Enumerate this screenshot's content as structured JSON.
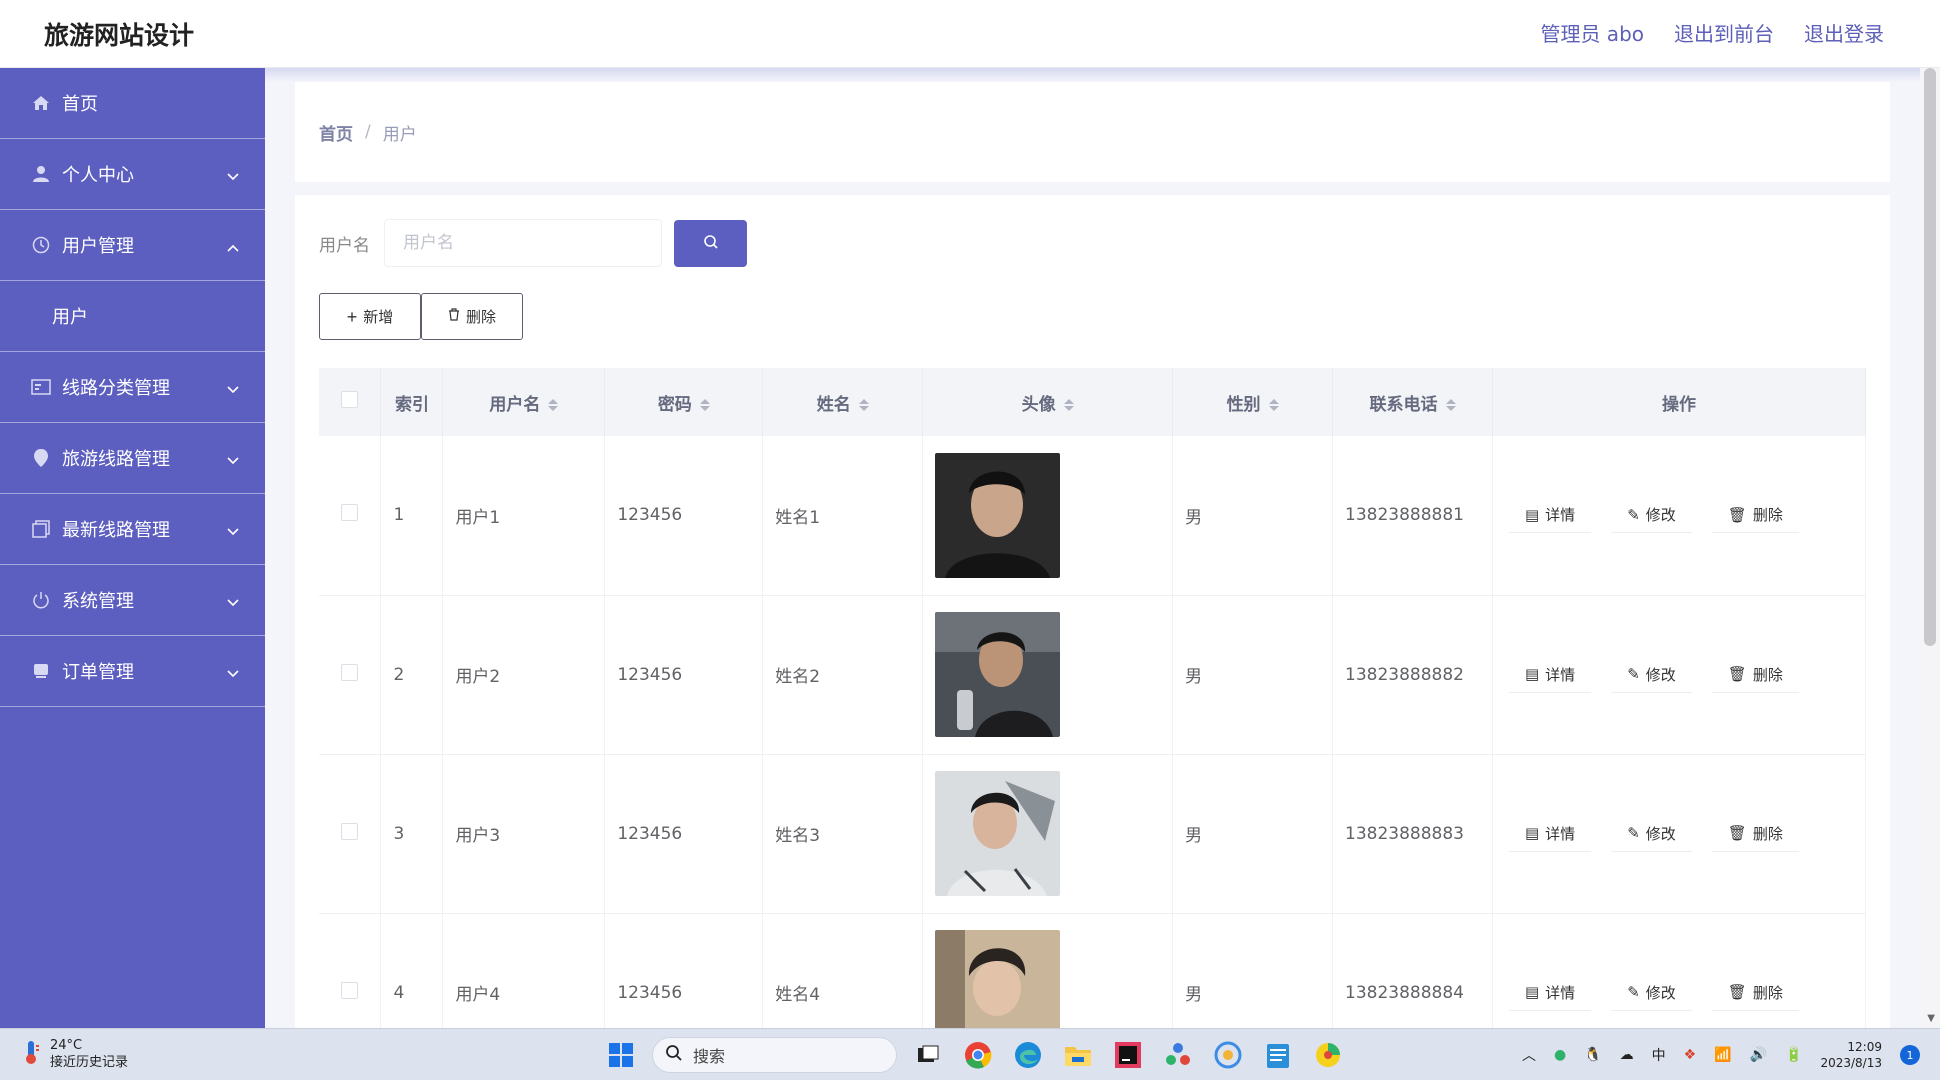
{
  "app": {
    "title": "旅游网站设计",
    "header_links": [
      "管理员 abo",
      "退出到前台",
      "退出登录"
    ]
  },
  "sidebar": {
    "items": [
      {
        "label": "首页",
        "icon": "home-icon"
      },
      {
        "label": "个人中心",
        "icon": "user-icon"
      },
      {
        "label": "用户管理",
        "icon": "clock-icon",
        "expanded": true
      },
      {
        "label": "用户",
        "sub": true
      },
      {
        "label": "线路分类管理",
        "icon": "card-icon"
      },
      {
        "label": "旅游线路管理",
        "icon": "location-icon"
      },
      {
        "label": "最新线路管理",
        "icon": "copy-icon"
      },
      {
        "label": "系统管理",
        "icon": "power-icon"
      },
      {
        "label": "订单管理",
        "icon": "box-icon"
      }
    ]
  },
  "breadcrumb": {
    "home": "首页",
    "separator": "/",
    "current": "用户"
  },
  "search": {
    "label": "用户名",
    "placeholder": "用户名",
    "value": ""
  },
  "buttons": {
    "add": "新增",
    "delete": "删除"
  },
  "table": {
    "columns": [
      "索引",
      "用户名",
      "密码",
      "姓名",
      "头像",
      "性别",
      "联系电话",
      "操作"
    ],
    "rows": [
      {
        "index": "1",
        "username": "用户1",
        "password": "123456",
        "name": "姓名1",
        "gender": "男",
        "phone": "13823888881"
      },
      {
        "index": "2",
        "username": "用户2",
        "password": "123456",
        "name": "姓名2",
        "gender": "男",
        "phone": "13823888882"
      },
      {
        "index": "3",
        "username": "用户3",
        "password": "123456",
        "name": "姓名3",
        "gender": "男",
        "phone": "13823888883"
      },
      {
        "index": "4",
        "username": "用户4",
        "password": "123456",
        "name": "姓名4",
        "gender": "男",
        "phone": "13823888884"
      }
    ],
    "actions": {
      "detail": "详情",
      "edit": "修改",
      "delete": "删除"
    }
  },
  "taskbar": {
    "weather_temp": "24°C",
    "weather_desc": "接近历史记录",
    "search_label": "搜索",
    "time": "12:09",
    "date": "2023/8/13",
    "notifications": "1",
    "ime": "中"
  },
  "colors": {
    "accent": "#5c5fbf",
    "header_link": "#5d5fb8"
  }
}
